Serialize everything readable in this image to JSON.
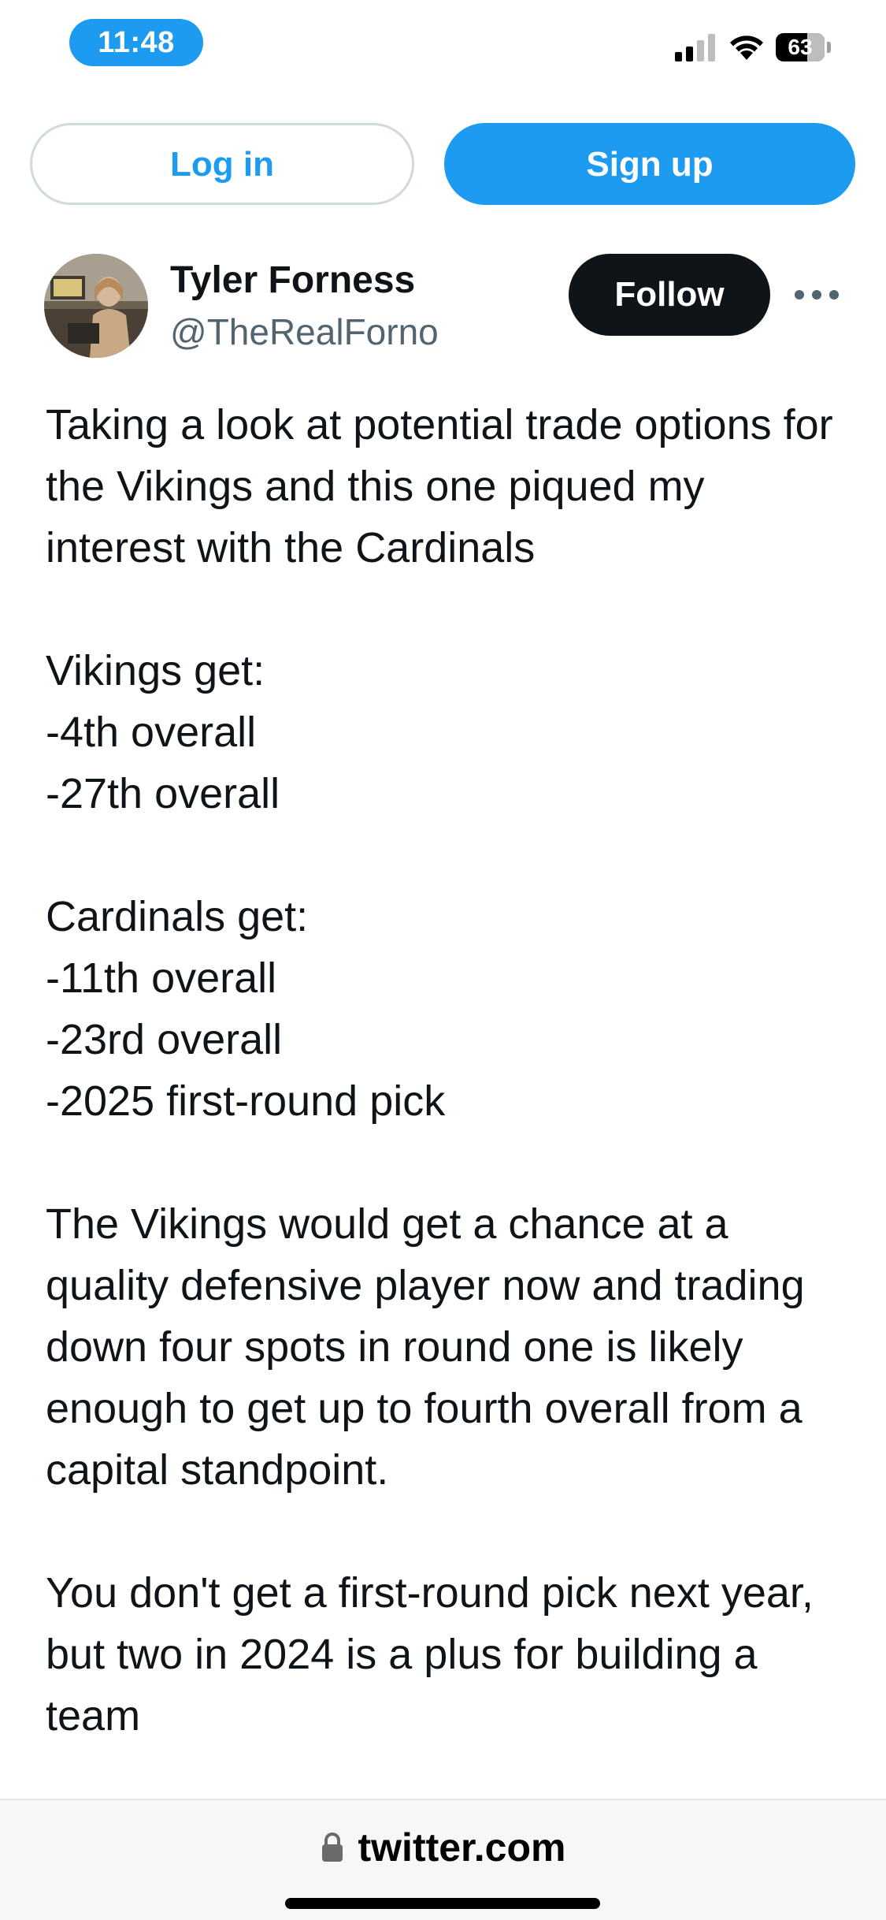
{
  "status_bar": {
    "time": "11:48",
    "battery": "63",
    "icons": [
      "signal-icon",
      "wifi-icon",
      "battery-icon"
    ],
    "accent_color": "#1d9bf0"
  },
  "auth": {
    "login_label": "Log in",
    "signup_label": "Sign up"
  },
  "tweet": {
    "author_name": "Tyler Forness",
    "author_handle": "@TheRealForno",
    "follow_label": "Follow",
    "more_icon": "more-icon",
    "text": "Taking a look at potential trade options for the Vikings and this one piqued my interest with the Cardinals\n\nVikings get:\n-4th overall\n-27th overall\n\nCardinals get:\n-11th overall\n-23rd overall\n-2025 first-round pick\n\nThe Vikings would get a chance at a quality defensive player now and trading down four spots in round one is likely enough to get up to fourth overall from a capital standpoint.\n\nYou don't get a first-round pick next year, but two in 2024 is a plus for building a team"
  },
  "browser": {
    "url": "twitter.com",
    "lock_icon": "lock-icon"
  },
  "colors": {
    "brand": "#1d9bf0",
    "text_primary": "#0f1419",
    "text_secondary": "#536471",
    "follow_bg": "#0f1419"
  }
}
